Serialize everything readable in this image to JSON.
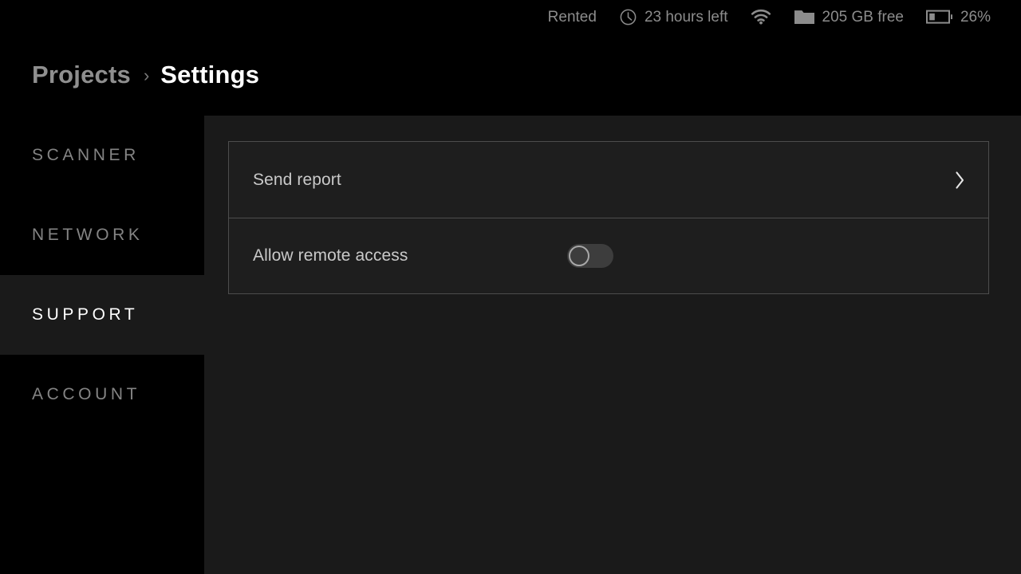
{
  "statusbar": {
    "items": [
      {
        "icon": "none",
        "icon_name": "rented-status",
        "label": "Rented"
      },
      {
        "icon": "clock",
        "icon_name": "clock-icon",
        "label": "23 hours left"
      },
      {
        "icon": "wifi",
        "icon_name": "wifi-icon",
        "label": ""
      },
      {
        "icon": "folder",
        "icon_name": "folder-icon",
        "label": "205 GB free"
      },
      {
        "icon": "battery",
        "icon_name": "battery-icon",
        "label": "26%"
      }
    ],
    "battery_percent": 26,
    "text_color": "#8c8c8c"
  },
  "header": {
    "breadcrumb_parent": "Projects",
    "breadcrumb_separator": "›",
    "breadcrumb_current": "Settings"
  },
  "sidebar": {
    "items": [
      {
        "label": "SCANNER",
        "active": false
      },
      {
        "label": "NETWORK",
        "active": false
      },
      {
        "label": "SUPPORT",
        "active": true
      },
      {
        "label": "ACCOUNT",
        "active": false
      }
    ],
    "active_bg": "#1a1a1a",
    "inactive_color": "#848484",
    "active_color": "#ffffff"
  },
  "main": {
    "card": {
      "rows": [
        {
          "type": "link",
          "label": "Send report",
          "chevron": "›"
        },
        {
          "type": "toggle",
          "label": "Allow remote access",
          "toggle_state": "off"
        }
      ],
      "border_color": "#4d4d4d",
      "background": "#1e1e1e"
    }
  }
}
